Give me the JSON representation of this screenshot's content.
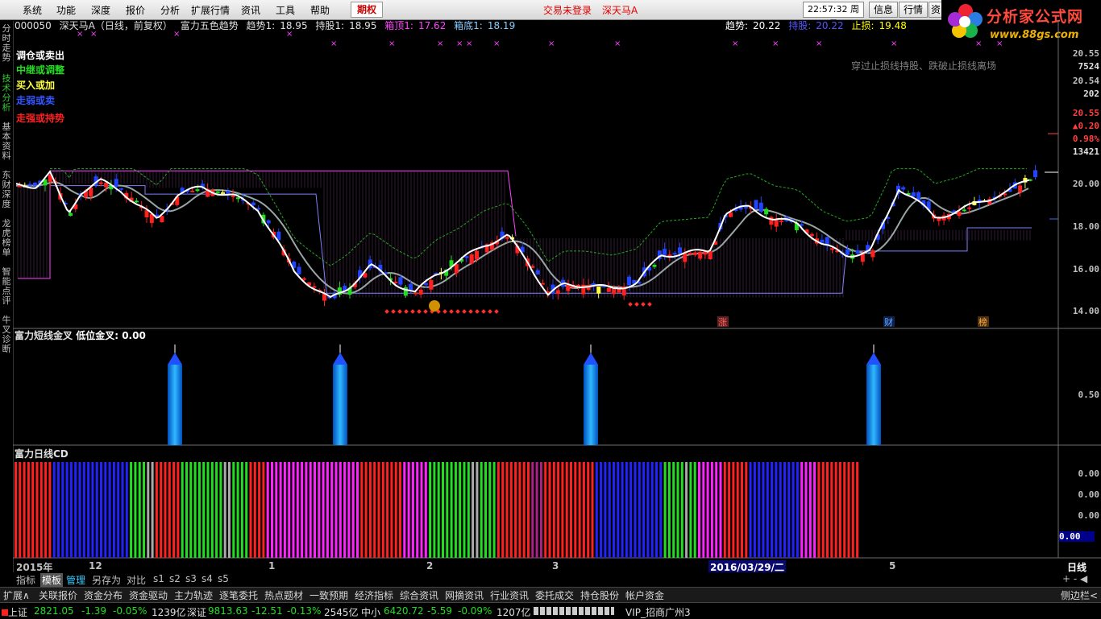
{
  "menu": {
    "items": [
      "系统",
      "功能",
      "深度",
      "报价",
      "分析",
      "扩展行情",
      "资讯",
      "工具",
      "帮助"
    ],
    "qq_label": "期权",
    "login_status": "交易未登录",
    "stock_tag": "深天马A",
    "time": "22:57:32",
    "weekday": "周日",
    "btn_info": "信息",
    "btn_quote": "行情",
    "btn_more": "资"
  },
  "logo": {
    "name": "分析家公式网",
    "url": "www.88gs.com"
  },
  "sidebar": [
    "分时走势",
    "技术分析",
    "基本资料",
    "东财深度",
    "龙虎榜单",
    "智能点评",
    "牛叉诊断"
  ],
  "price_info": {
    "code": "000050",
    "name": "深天马A（日线，前复权）",
    "indicator": "富力五色趋势",
    "trend1_label": "趋势1:",
    "trend1_value": "18.95",
    "hold1_label": "持股1:",
    "hold1_value": "18.95",
    "boxtop1_label": "箱顶1:",
    "boxtop1_value": "17.62",
    "boxbottom1_label": "箱底1:",
    "boxbottom1_value": "18.19",
    "trend_label": "趋势:",
    "trend_value": "20.22",
    "hold_label": "持股:",
    "hold_value": "20.22",
    "stop_label": "止损:",
    "stop_value": "19.48"
  },
  "legend": [
    {
      "text": "调仓或卖出",
      "color": "#ffffff"
    },
    {
      "text": "中继或调整",
      "color": "#22dd22"
    },
    {
      "text": "买入或加",
      "color": "#ffff40"
    },
    {
      "text": "走弱或卖",
      "color": "#3355ff"
    },
    {
      "text": "走强或持势",
      "color": "#ff2020"
    }
  ],
  "annotation": "穿过止损线持股、跌破止损线离场",
  "right_axis": {
    "price": [
      "20.55",
      "7524",
      "20.54",
      "202",
      "20.55",
      "▲0.20",
      "0.98%",
      "13421",
      "20.00",
      "18.00",
      "16.00",
      "14.00"
    ],
    "sub1": "0.50",
    "sub2": [
      "0.00",
      "0.00",
      "0.00",
      "0.00"
    ]
  },
  "markers": {
    "m1": "涨",
    "m2": "财",
    "m3": "榜"
  },
  "sub1_title": "富力短线金叉",
  "sub1_value_label": "低位金叉:",
  "sub1_value": "0.00",
  "sub2_title": "富力日线CD",
  "x_axis": [
    "2015年",
    "12",
    "1",
    "2",
    "3",
    "2016/03/29/二",
    "5"
  ],
  "period_label": "日线",
  "tabs": [
    "指标",
    "模板",
    "管理",
    "另存为",
    "对比",
    "s1",
    "s2",
    "s3",
    "s4",
    "s5"
  ],
  "tab_right": "+ - ◀",
  "toolbar": [
    "扩展∧",
    "关联报价",
    "资金分布",
    "资金驱动",
    "主力轨迹",
    "逐笔委托",
    "热点题材",
    "一致预期",
    "经济指标",
    "综合资讯",
    "网摘资讯",
    "行业资讯",
    "委托成交",
    "持仓股份",
    "帐户资金"
  ],
  "toolbar_right": "侧边栏<",
  "status": {
    "sh_label": "上证",
    "sh_index": "2821.05",
    "sh_chg": "-1.39",
    "sh_pct": "-0.05%",
    "sh_amt": "1239亿",
    "sz_label": "深证",
    "sz_index": "9813.63",
    "sz_chg": "-12.51",
    "sz_pct": "-0.13%",
    "sz_amt": "2545亿",
    "zx_label": "中小",
    "zx_index": "6420.72",
    "zx_chg": "-5.59",
    "zx_pct": "-0.09%",
    "zx_amt": "1207亿",
    "vip": "VIP_招商广州3"
  },
  "colors": {
    "up": "#ff2020",
    "down": "#2244ff",
    "mid": "#22dd22",
    "buy": "#ffff40",
    "sell": "#ffffff",
    "magenta": "#ff33ff",
    "grey": "#9aa6a6"
  },
  "chart_data": [
    {
      "type": "candlestick",
      "title": "富力五色趋势",
      "ylim": [
        13.5,
        20.8
      ],
      "y_ticks": [
        14,
        16,
        18,
        20
      ],
      "grid": false
    },
    {
      "type": "bar",
      "title": "富力短线金叉",
      "values": [
        1,
        1,
        1,
        1
      ],
      "ylim": [
        0,
        1
      ]
    },
    {
      "type": "bar",
      "title": "富力日线CD",
      "colors": [
        "#ff2020",
        "#2222ff",
        "#22dd22",
        "#aaaaaa",
        "#ff22ff"
      ]
    }
  ]
}
